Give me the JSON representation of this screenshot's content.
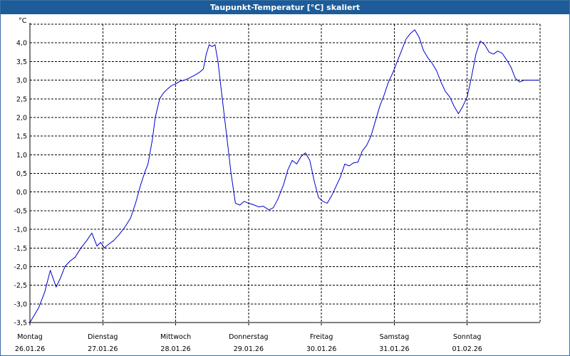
{
  "window": {
    "title": "Taupunkt-Temperatur [°C] skaliert"
  },
  "colors": {
    "titlebar": "#1d5c98",
    "line": "#0000cc",
    "grid": "#000000",
    "background": "#ffffff"
  },
  "chart_data": {
    "type": "line",
    "title": "Taupunkt-Temperatur [°C] skaliert",
    "ylabel": "°C",
    "ylim": [
      -3.5,
      4.5
    ],
    "yticks": [
      -3.5,
      -3.0,
      -2.5,
      -2.0,
      -1.5,
      -1.0,
      -0.5,
      0.0,
      0.5,
      1.0,
      1.5,
      2.0,
      2.5,
      3.0,
      3.5,
      4.0
    ],
    "ytick_labels": [
      "-3,5",
      "-3,0",
      "-2,5",
      "-2,0",
      "-1,5",
      "-1,0",
      "-0,5",
      "0,0",
      "0,5",
      "1,0",
      "1,5",
      "2,0",
      "2,5",
      "3,0",
      "3,5",
      "4,0"
    ],
    "xlim": [
      0,
      7
    ],
    "x_unit": "days from 26.01.26 00:00",
    "grid": true,
    "days": [
      {
        "weekday": "Montag",
        "date": "26.01.26"
      },
      {
        "weekday": "Dienstag",
        "date": "27.01.26"
      },
      {
        "weekday": "Mittwoch",
        "date": "28.01.26"
      },
      {
        "weekday": "Donnerstag",
        "date": "29.01.26"
      },
      {
        "weekday": "Freitag",
        "date": "30.01.26"
      },
      {
        "weekday": "Samstag",
        "date": "31.01.26"
      },
      {
        "weekday": "Sonntag",
        "date": "01.02.26"
      }
    ],
    "series": [
      {
        "color": "#0000cc",
        "x": [
          0,
          0.12,
          0.2,
          0.28,
          0.36,
          0.42,
          0.48,
          0.55,
          0.62,
          0.7,
          0.78,
          0.85,
          0.92,
          0.97,
          1.02,
          1.08,
          1.15,
          1.22,
          1.3,
          1.38,
          1.45,
          1.52,
          1.58,
          1.62,
          1.68,
          1.72,
          1.78,
          1.83,
          1.88,
          1.94,
          2.0,
          2.06,
          2.12,
          2.18,
          2.25,
          2.32,
          2.38,
          2.42,
          2.46,
          2.5,
          2.54,
          2.58,
          2.64,
          2.7,
          2.76,
          2.82,
          2.88,
          2.94,
          3.0,
          3.08,
          3.14,
          3.2,
          3.28,
          3.34,
          3.4,
          3.48,
          3.54,
          3.6,
          3.66,
          3.72,
          3.78,
          3.84,
          3.9,
          3.96,
          4.02,
          4.08,
          4.14,
          4.2,
          4.26,
          4.32,
          4.38,
          4.44,
          4.5,
          4.56,
          4.62,
          4.68,
          4.74,
          4.8,
          4.86,
          4.92,
          4.98,
          5.04,
          5.1,
          5.16,
          5.22,
          5.28,
          5.34,
          5.4,
          5.46,
          5.52,
          5.58,
          5.64,
          5.7,
          5.76,
          5.82,
          5.88,
          5.94,
          6.0,
          6.06,
          6.12,
          6.18,
          6.24,
          6.3,
          6.36,
          6.42,
          6.48,
          6.54,
          6.6,
          6.66,
          6.72,
          6.78,
          6.84,
          6.9,
          6.96,
          7.0
        ],
        "y": [
          -3.5,
          -3.1,
          -2.7,
          -2.1,
          -2.55,
          -2.3,
          -2.0,
          -1.85,
          -1.75,
          -1.5,
          -1.3,
          -1.1,
          -1.45,
          -1.35,
          -1.5,
          -1.4,
          -1.3,
          -1.15,
          -0.95,
          -0.7,
          -0.3,
          0.2,
          0.55,
          0.75,
          1.4,
          2.0,
          2.5,
          2.65,
          2.75,
          2.85,
          2.9,
          2.97,
          3.0,
          3.05,
          3.12,
          3.2,
          3.3,
          3.7,
          3.95,
          3.9,
          3.95,
          3.5,
          2.5,
          1.5,
          0.5,
          -0.3,
          -0.35,
          -0.25,
          -0.3,
          -0.35,
          -0.4,
          -0.38,
          -0.48,
          -0.42,
          -0.2,
          0.2,
          0.6,
          0.85,
          0.75,
          0.95,
          1.05,
          0.85,
          0.3,
          -0.15,
          -0.25,
          -0.3,
          -0.1,
          0.15,
          0.4,
          0.75,
          0.7,
          0.78,
          0.8,
          1.1,
          1.25,
          1.5,
          1.9,
          2.3,
          2.6,
          2.95,
          3.2,
          3.5,
          3.8,
          4.1,
          4.25,
          4.35,
          4.15,
          3.8,
          3.6,
          3.45,
          3.25,
          2.95,
          2.7,
          2.55,
          2.3,
          2.1,
          2.3,
          2.55,
          3.1,
          3.7,
          4.05,
          3.95,
          3.75,
          3.7,
          3.78,
          3.72,
          3.55,
          3.35,
          3.05,
          2.95,
          3.0,
          3.0,
          3.0,
          3.0,
          3.0
        ]
      }
    ]
  }
}
